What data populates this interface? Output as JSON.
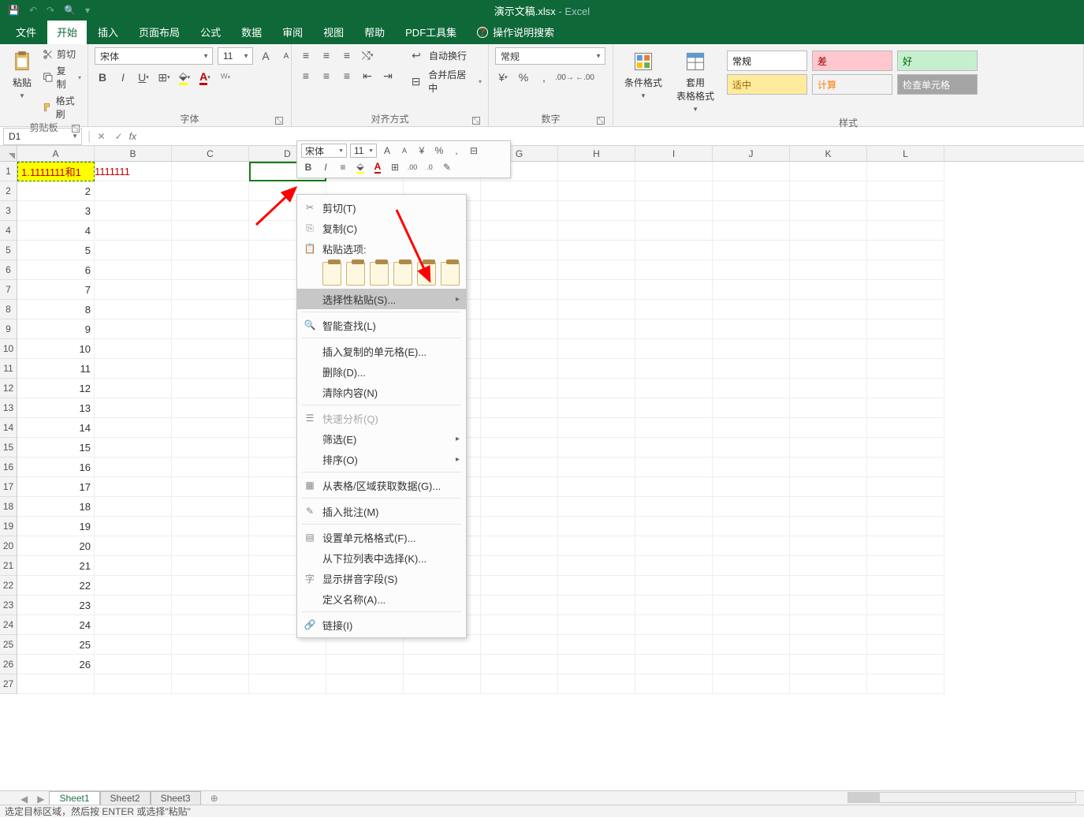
{
  "window": {
    "filename": "演示文稿.xlsx",
    "app": "Excel"
  },
  "qat_icons": [
    "save",
    "undo",
    "redo",
    "preview",
    "custom"
  ],
  "tabs": {
    "file": "文件",
    "home": "开始",
    "insert": "插入",
    "layout": "页面布局",
    "formulas": "公式",
    "data": "数据",
    "review": "审阅",
    "view": "视图",
    "help": "帮助",
    "pdf": "PDF工具集",
    "tellme": "操作说明搜索"
  },
  "ribbon": {
    "clipboard": {
      "paste": "粘贴",
      "cut": "剪切",
      "copy": "复制",
      "painter": "格式刷",
      "group": "剪贴板"
    },
    "font": {
      "name": "宋体",
      "size": "11",
      "group": "字体"
    },
    "align": {
      "wrap": "自动换行",
      "merge": "合并后居中",
      "group": "对齐方式"
    },
    "number": {
      "format": "常规",
      "group": "数字"
    },
    "styles": {
      "cond": "条件格式",
      "table": "套用\n表格格式",
      "cells": {
        "normal": "常规",
        "bad": "差",
        "good": "好",
        "neutral": "适中",
        "calc": "计算",
        "check": "检查单元格"
      },
      "group": "样式"
    }
  },
  "namebox": "D1",
  "minibar": {
    "font": "宋体",
    "size": "11"
  },
  "context_menu": {
    "cut": "剪切(T)",
    "copy": "复制(C)",
    "paste_opts": "粘贴选项:",
    "paste_special": "选择性粘贴(S)...",
    "smart_lookup": "智能查找(L)",
    "insert_copied": "插入复制的单元格(E)...",
    "delete": "删除(D)...",
    "clear": "清除内容(N)",
    "quick": "快速分析(Q)",
    "filter": "筛选(E)",
    "sort": "排序(O)",
    "get_data": "从表格/区域获取数据(G)...",
    "comment": "插入批注(M)",
    "format": "设置单元格格式(F)...",
    "dropdown": "从下拉列表中选择(K)...",
    "pinyin": "显示拼音字段(S)",
    "name": "定义名称(A)...",
    "link": "链接(I)"
  },
  "columns": [
    "A",
    "B",
    "C",
    "D",
    "E",
    "F",
    "G",
    "H",
    "I",
    "J",
    "K",
    "L"
  ],
  "rows": [
    {
      "n": "1",
      "A_display": "1.1111111和1",
      "overflow": "1111111"
    },
    {
      "n": "2",
      "A": "2"
    },
    {
      "n": "3",
      "A": "3"
    },
    {
      "n": "4",
      "A": "4"
    },
    {
      "n": "5",
      "A": "5"
    },
    {
      "n": "6",
      "A": "6"
    },
    {
      "n": "7",
      "A": "7"
    },
    {
      "n": "8",
      "A": "8"
    },
    {
      "n": "9",
      "A": "9"
    },
    {
      "n": "10",
      "A": "10"
    },
    {
      "n": "11",
      "A": "11"
    },
    {
      "n": "12",
      "A": "12"
    },
    {
      "n": "13",
      "A": "13"
    },
    {
      "n": "14",
      "A": "14"
    },
    {
      "n": "15",
      "A": "15"
    },
    {
      "n": "16",
      "A": "16"
    },
    {
      "n": "17",
      "A": "17"
    },
    {
      "n": "18",
      "A": "18"
    },
    {
      "n": "19",
      "A": "19"
    },
    {
      "n": "20",
      "A": "20"
    },
    {
      "n": "21",
      "A": "21"
    },
    {
      "n": "22",
      "A": "22"
    },
    {
      "n": "23",
      "A": "23"
    },
    {
      "n": "24",
      "A": "24"
    },
    {
      "n": "25",
      "A": "25"
    },
    {
      "n": "26",
      "A": "26"
    },
    {
      "n": "27",
      "A": ""
    }
  ],
  "sheets": {
    "s1": "Sheet1",
    "s2": "Sheet2",
    "s3": "Sheet3"
  },
  "status": "选定目标区域，然后按 ENTER 或选择\"粘贴\""
}
